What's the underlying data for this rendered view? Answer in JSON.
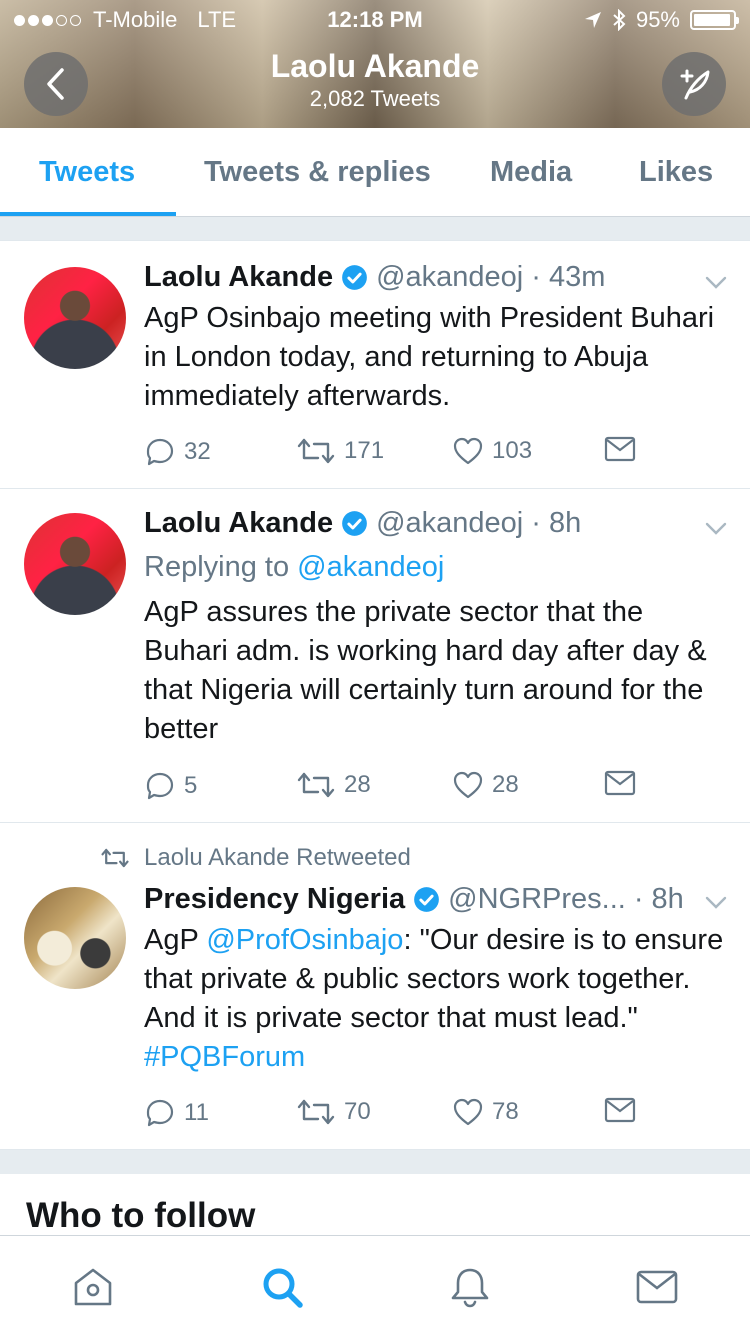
{
  "status_bar": {
    "carrier": "T-Mobile",
    "network": "LTE",
    "time": "12:18 PM",
    "battery": "95%",
    "signal_dots_filled": 3,
    "signal_dots_total": 5
  },
  "header": {
    "title": "Laolu Akande",
    "subtitle": "2,082 Tweets"
  },
  "tabs": [
    {
      "label": "Tweets",
      "active": true
    },
    {
      "label": "Tweets & replies",
      "active": false
    },
    {
      "label": "Media",
      "active": false
    },
    {
      "label": "Likes",
      "active": false
    }
  ],
  "tweets": [
    {
      "name": "Laolu Akande",
      "handle": "@akandeoj",
      "time": "· 43m",
      "text": "AgP Osinbajo meeting with President Buhari in London today, and returning to Abuja immediately afterwards.",
      "replies": "32",
      "retweets": "171",
      "likes": "103"
    },
    {
      "name": "Laolu Akande",
      "handle": "@akandeoj",
      "time": "· 8h",
      "reply_prefix": "Replying to",
      "reply_handle": "@akandeoj",
      "text": "AgP assures the private sector that the Buhari adm.  is working hard day after day & that Nigeria will certainly turn around for the better",
      "replies": "5",
      "retweets": "28",
      "likes": "28"
    },
    {
      "retweeted_by": "Laolu Akande Retweeted",
      "name": "Presidency Nigeria",
      "handle": "@NGRPres...",
      "time": "· 8h",
      "text_parts": {
        "a": "AgP ",
        "mention": "@ProfOsinbajo",
        "b": ": \"Our desire is to ensure that private & public sectors work together. And it is private sector that must lead.\" ",
        "hashtag": "#PQBForum"
      },
      "replies": "11",
      "retweets": "70",
      "likes": "78"
    }
  ],
  "who_to_follow": "Who to follow",
  "bottom_nav": [
    "home-icon",
    "search-icon",
    "notifications-icon",
    "messages-icon"
  ],
  "colors": {
    "accent": "#1da1f2",
    "muted": "#657786",
    "text": "#14171a"
  }
}
